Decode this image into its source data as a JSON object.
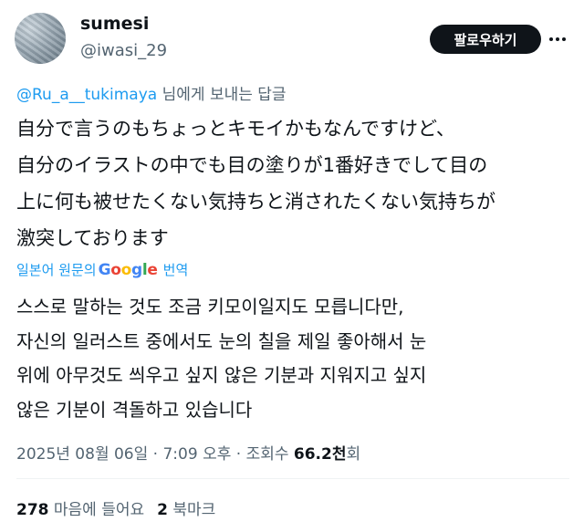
{
  "user": {
    "display_name": "sumesi",
    "handle": "@iwasi_29",
    "follow_label": "팔로우하기"
  },
  "reply": {
    "mention": "@Ru_a__tukimaya",
    "suffix": " 님에게 보내는 답글"
  },
  "tweet": {
    "lines": [
      "自分で言うのもちょっとキモイかもなんですけど、",
      "自分のイラストの中でも目の塗りが1番好きでして目の",
      "上に何も被せたくない気持ちと消されたくない気持ちが",
      "激突しております"
    ]
  },
  "translation": {
    "prefix": "일본어 원문의",
    "google": "Google",
    "suffix": "번역",
    "lines": [
      "스스로 말하는 것도 조금 키모이일지도 모릅니다만,",
      "자신의 일러스트 중에서도 눈의 칠을 제일 좋아해서 눈",
      "위에 아무것도 씌우고 싶지 않은 기분과 지워지고 싶지",
      "않은 기분이 격돌하고 있습니다"
    ]
  },
  "meta": {
    "date": "2025년 08월 06일",
    "time": "7:09 오후",
    "views_prefix": "조회수",
    "views_num": "66.2천",
    "views_suffix": "회"
  },
  "stats": {
    "likes_count": "278",
    "likes_label": "마음에 들어요",
    "bookmarks_count": "2",
    "bookmarks_label": "북마크"
  }
}
